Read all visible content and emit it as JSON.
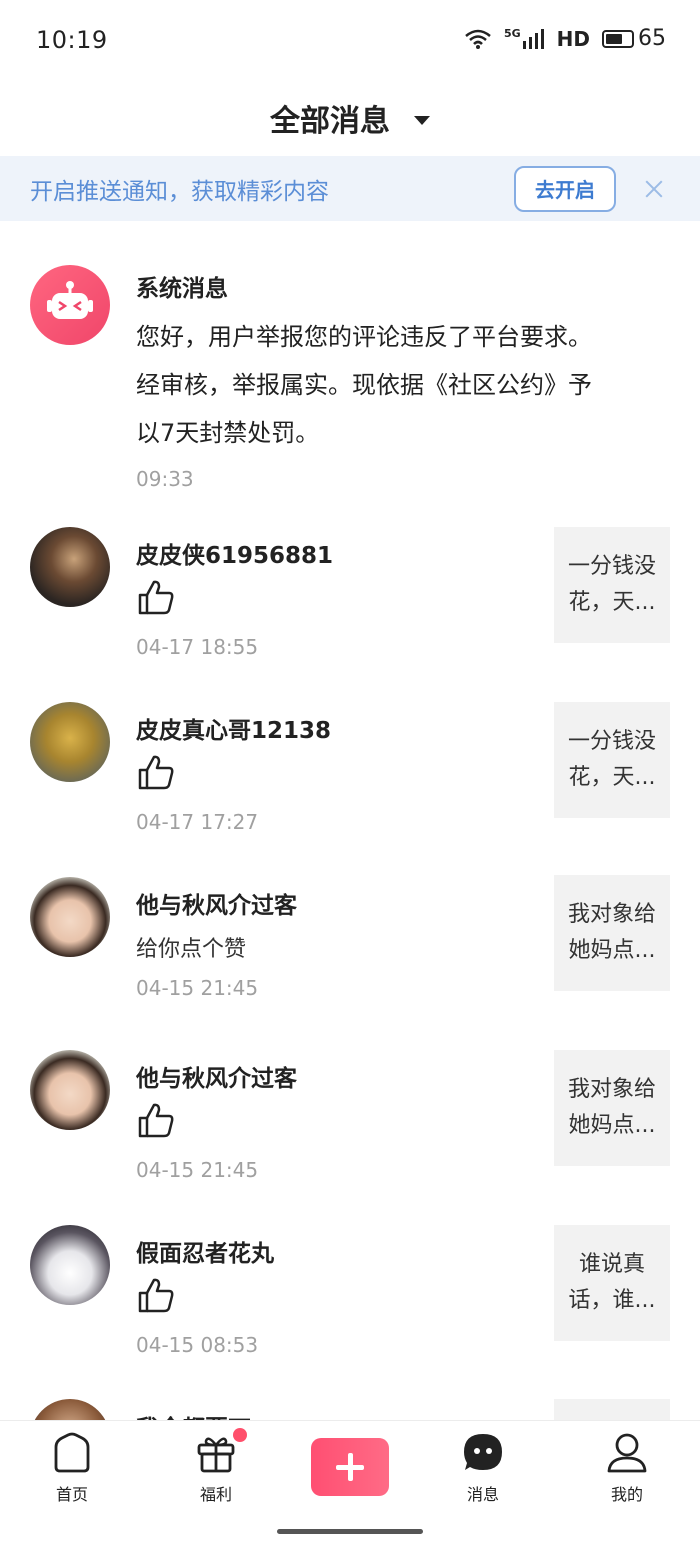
{
  "status_bar": {
    "time": "10:19",
    "signal": "5G",
    "network": "HD",
    "battery": "65",
    "battery_level": 0.65
  },
  "header": {
    "title": "全部消息"
  },
  "push_banner": {
    "text": "开启推送通知，获取精彩内容",
    "button": "去开启"
  },
  "messages": [
    {
      "name": "系统消息",
      "text": "您好，用户举报您的评论违反了平台要求。经审核，举报属实。现依据《社区公约》予以7天封禁处罚。",
      "text_lines": [
        "您好，用户举报您的评论违反了平台要求。",
        "经审核，举报属实。现依据《社区公约》予",
        "以7天封禁处罚。"
      ],
      "time": "09:33",
      "avatar": "robot-icon"
    },
    {
      "name": "皮皮侠61956881",
      "action": "like",
      "time": "04-17 18:55",
      "preview": "一分钱没花，天..."
    },
    {
      "name": "皮皮真心哥12138",
      "action": "like",
      "time": "04-17 17:27",
      "preview": "一分钱没花，天..."
    },
    {
      "name": "他与秋风介过客",
      "text": "给你点个赞",
      "time": "04-15 21:45",
      "preview": "我对象给她妈点..."
    },
    {
      "name": "他与秋风介过客",
      "action": "like",
      "time": "04-15 21:45",
      "preview": "我对象给她妈点..."
    },
    {
      "name": "假面忍者花丸",
      "action": "like",
      "time": "04-15 08:53",
      "preview": "谁说真话，谁..."
    },
    {
      "name": "我全都要丁",
      "preview": ""
    }
  ],
  "bottom_nav": {
    "home": "首页",
    "welfare": "福利",
    "messages": "消息",
    "me": "我的"
  },
  "colors": {
    "accent_pink": "#FF4F72",
    "banner_bg": "#EEF3FA",
    "banner_text": "#5B8ED6"
  }
}
